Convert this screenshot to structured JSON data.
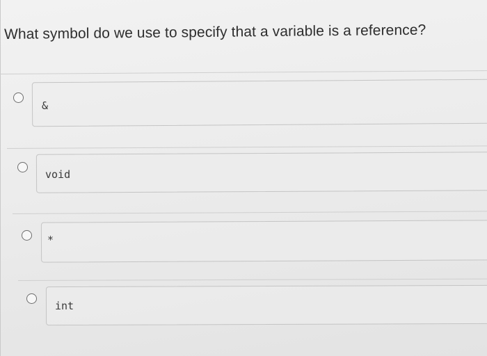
{
  "question": {
    "text": "What symbol do we use to specify that a variable is a reference?"
  },
  "options": [
    {
      "label": "&"
    },
    {
      "label": "void"
    },
    {
      "label": "*"
    },
    {
      "label": "int"
    }
  ]
}
